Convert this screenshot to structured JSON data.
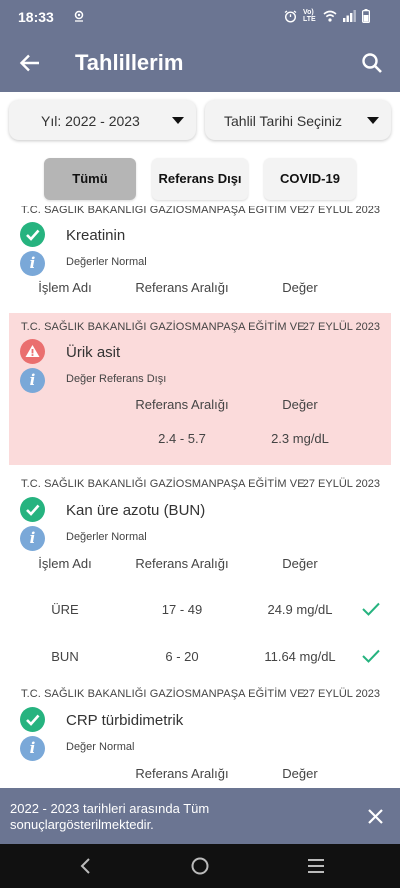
{
  "status_bar": {
    "time": "18:33",
    "network": "Vo) LTE"
  },
  "app_bar": {
    "title": "Tahlillerim"
  },
  "filters": {
    "year_label": "Yıl: 2022 - 2023",
    "date_label": "Tahlil Tarihi Seçiniz"
  },
  "tabs": [
    {
      "label": "Tümü",
      "active": true
    },
    {
      "label": "Referans Dışı",
      "active": false
    },
    {
      "label": "COVID-19",
      "active": false
    }
  ],
  "results": [
    {
      "hospital": "T.C. SAĞLIK BAKANLIĞI GAZİOSMANPAŞA EĞİTİM VE",
      "date": "27 EYLÜL 2023",
      "name": "Kreatinin",
      "status": "Değerler Normal",
      "headers": {
        "process": "İşlem Adı",
        "reference": "Referans Aralığı",
        "value": "Değer"
      }
    },
    {
      "hospital": "T.C. SAĞLIK BAKANLIĞI GAZİOSMANPAŞA EĞİTİM VE",
      "date": "27 EYLÜL 2023",
      "name": "Ürik asit",
      "status": "Değer Referans Dışı",
      "headers": {
        "reference": "Referans Aralığı",
        "value": "Değer"
      },
      "row": {
        "reference": "2.4 - 5.7",
        "value": "2.3 mg/dL"
      }
    },
    {
      "hospital": "T.C. SAĞLIK BAKANLIĞI GAZİOSMANPAŞA EĞİTİM VE",
      "date": "27 EYLÜL 2023",
      "name": "Kan üre azotu (BUN)",
      "status": "Değerler Normal",
      "headers": {
        "process": "İşlem Adı",
        "reference": "Referans Aralığı",
        "value": "Değer"
      },
      "rows": [
        {
          "process": "ÜRE",
          "reference": "17 - 49",
          "value": "24.9 mg/dL"
        },
        {
          "process": "BUN",
          "reference": "6 - 20",
          "value": "11.64 mg/dL"
        }
      ]
    },
    {
      "hospital": "T.C. SAĞLIK BAKANLIĞI GAZİOSMANPAŞA EĞİTİM VE",
      "date": "27 EYLÜL 2023",
      "name": "CRP türbidimetrik",
      "status": "Değer Normal",
      "headers": {
        "reference": "Referans Aralığı",
        "value": "Değer"
      }
    }
  ],
  "toast": {
    "message": "2022 - 2023 tarihleri arasında Tüm sonuçlargösterilmektedir."
  },
  "colors": {
    "primary": "#6b7592",
    "ok": "#26b37f",
    "warn": "#ea6f6f",
    "info": "#7aa8d8",
    "alert_bg": "#fbdbdb"
  }
}
